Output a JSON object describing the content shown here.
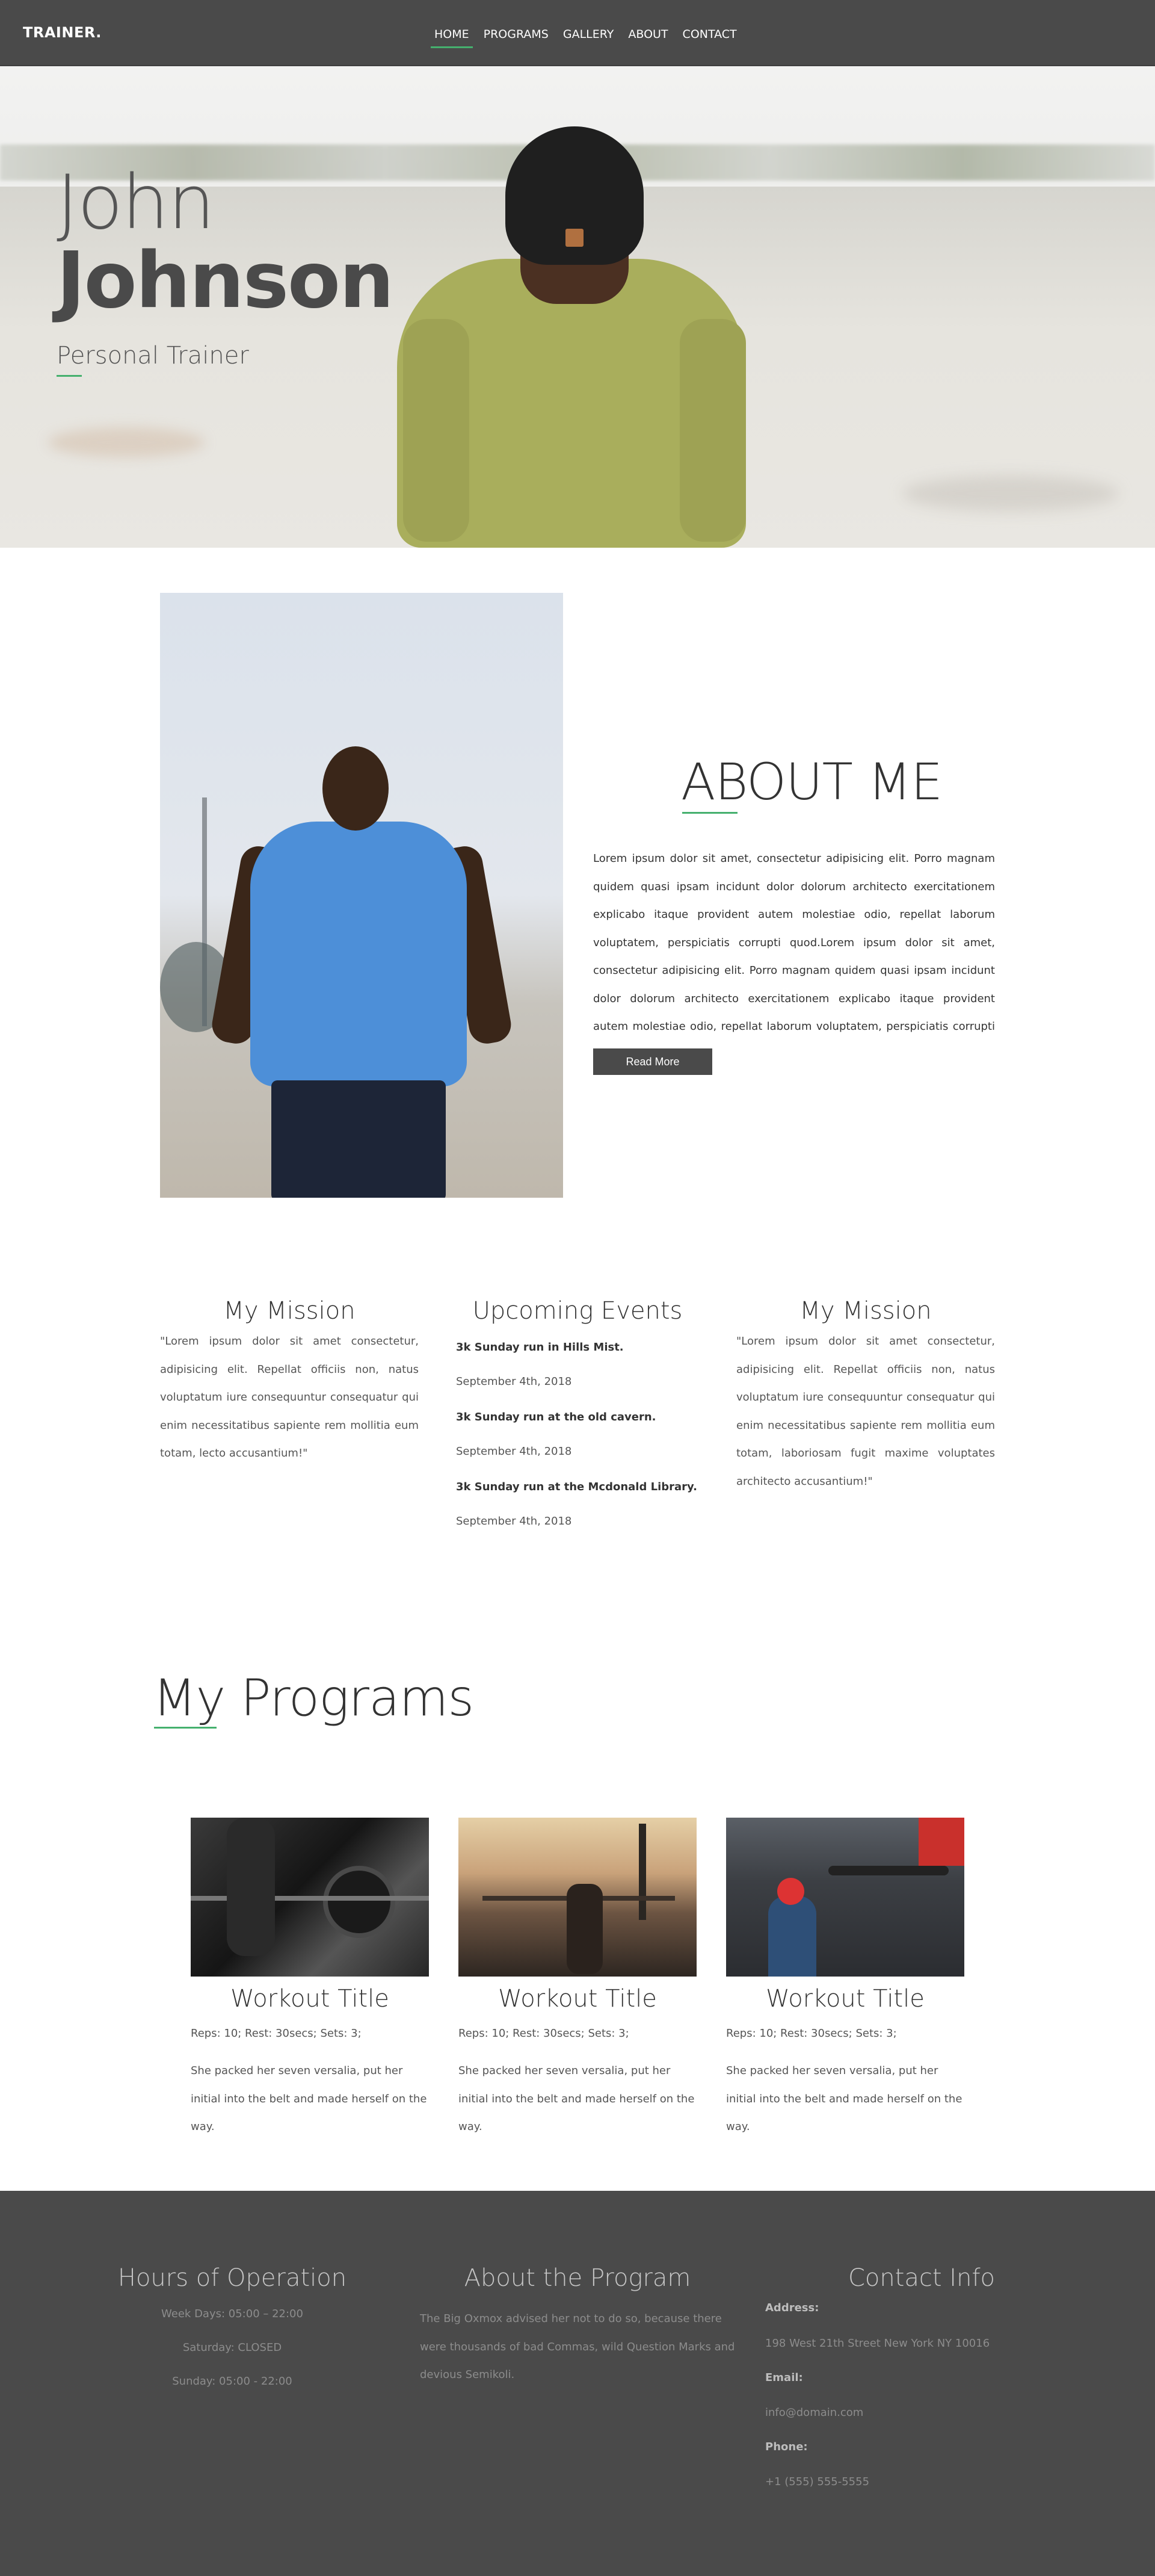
{
  "header": {
    "brand": "TRAINER.",
    "nav": [
      "HOME",
      "PROGRAMS",
      "GALLERY",
      "ABOUT",
      "CONTACT"
    ],
    "active_nav": "HOME"
  },
  "hero": {
    "first_name": "John",
    "last_name": "Johnson",
    "role": "Personal Trainer"
  },
  "about": {
    "title": "ABOUT ME",
    "text": "Lorem ipsum dolor sit amet, consectetur adipisicing elit. Porro magnam quidem quasi ipsam incidunt dolor dolorum architecto exercitationem explicabo itaque provident autem molestiae odio, repellat laborum voluptatem, perspiciatis corrupti quod.Lorem ipsum dolor sit amet, consectetur adipisicing elit. Porro magnam quidem quasi ipsam incidunt dolor dolorum architecto exercitationem explicabo itaque provident autem molestiae odio, repellat laborum voluptatem, perspiciatis corrupti quod.",
    "button": "Read More"
  },
  "columns": {
    "mission_left": {
      "title": "My Mission",
      "text": "\"Lorem ipsum dolor sit amet consectetur, adipisicing elit. Repellat officiis non, natus voluptatum iure consequuntur consequatur qui enim necessitatibus sapiente rem mollitia eum totam, lecto accusantium!\""
    },
    "events": {
      "title": "Upcoming Events",
      "items": [
        {
          "title": "3k Sunday run in Hills Mist.",
          "date": "September 4th, 2018"
        },
        {
          "title": "3k Sunday run at the old cavern.",
          "date": "September 4th, 2018"
        },
        {
          "title": "3k Sunday run at the Mcdonald Library.",
          "date": "September 4th, 2018"
        }
      ]
    },
    "mission_right": {
      "title": "My Mission",
      "text": "\"Lorem ipsum dolor sit amet consectetur, adipisicing elit. Repellat officiis non, natus voluptatum iure consequuntur consequatur qui enim necessitatibus sapiente rem mollitia eum totam, laboriosam fugit maxime voluptates architecto accusantium!\""
    }
  },
  "programs": {
    "title": "My Programs",
    "items": [
      {
        "title": "Workout Title",
        "meta": "Reps: 10; Rest: 30secs; Sets: 3;",
        "desc": "She packed her seven versalia, put her initial into the belt and made herself on the way."
      },
      {
        "title": "Workout Title",
        "meta": "Reps: 10; Rest: 30secs; Sets: 3;",
        "desc": "She packed her seven versalia, put her initial into the belt and made herself on the way."
      },
      {
        "title": "Workout Title",
        "meta": "Reps: 10; Rest: 30secs; Sets: 3;",
        "desc": "She packed her seven versalia, put her initial into the belt and made herself on the way."
      }
    ]
  },
  "footer": {
    "hours": {
      "title": "Hours of Operation",
      "lines": [
        "Week Days: 05:00 – 22:00",
        "Saturday: CLOSED",
        "Sunday: 05:00 - 22:00"
      ]
    },
    "program": {
      "title": "About the Program",
      "text": "The Big Oxmox advised her not to do so, because there were thousands of bad Commas, wild Question Marks and devious Semikoli."
    },
    "contact": {
      "title": "Contact Info",
      "address_label": "Address:",
      "address": "198 West 21th Street New York NY 10016",
      "email_label": "Email:",
      "email": "info@domain.com",
      "phone_label": "Phone:",
      "phone": "+1 (555) 555-5555"
    }
  },
  "colors": {
    "accent": "#45b06e",
    "dark": "#4a4a4a"
  }
}
